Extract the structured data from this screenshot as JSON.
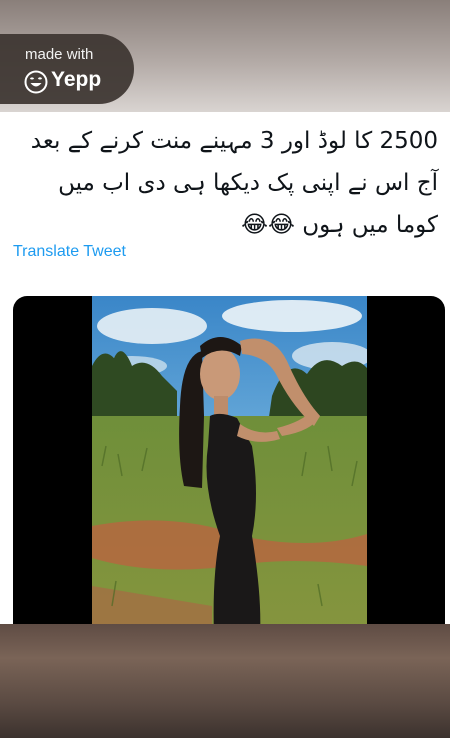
{
  "watermark": {
    "made_with": "made with",
    "brand": "Yepp",
    "logo_icon": "laughing-face-icon"
  },
  "tweet": {
    "lines": [
      "2500 کا لوڈ اور 3 مہینے منت کرنے کے بعد",
      "آج اس نے اپنی پک دیکھا ہی دی اب میں",
      "کوما میں ہوں 😂😂"
    ],
    "translate_label": "Translate Tweet"
  },
  "media": {
    "type": "photo"
  },
  "colors": {
    "link": "#1d9bf0",
    "text": "#0f1419"
  }
}
